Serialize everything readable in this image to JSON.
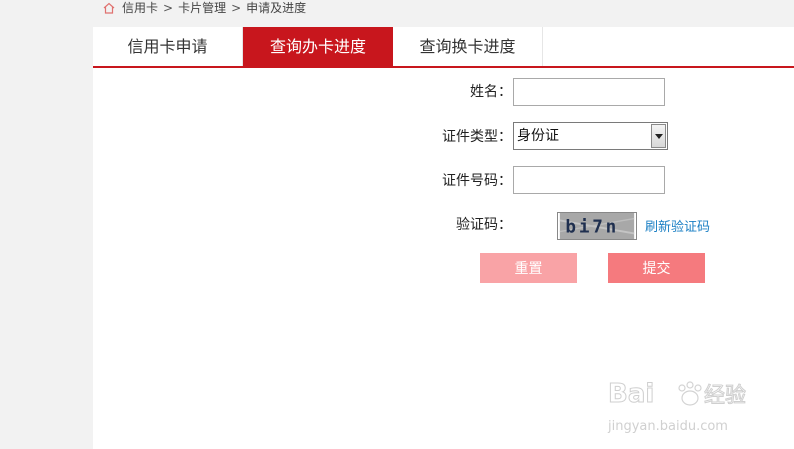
{
  "breadcrumb": {
    "item1": "信用卡",
    "item2": "卡片管理",
    "item3": "申请及进度",
    "sep": ">"
  },
  "tabs": [
    {
      "label": "信用卡申请"
    },
    {
      "label": "查询办卡进度"
    },
    {
      "label": "查询换卡进度"
    }
  ],
  "form": {
    "name_label": "姓名：",
    "name_value": "",
    "id_type_label": "证件类型：",
    "id_type_value": "身份证",
    "id_number_label": "证件号码：",
    "id_number_value": "",
    "captcha_label": "验证码：",
    "captcha_text": "bi7n",
    "refresh_label": "刷新验证码"
  },
  "buttons": {
    "reset": "重置",
    "submit": "提交"
  },
  "watermark": {
    "brand": "Baidu",
    "cn": "经验",
    "url": "jingyan.baidu.com"
  },
  "colors": {
    "accent": "#c8161d",
    "link": "#1a7fc4",
    "reset_btn": "#f9a3a6",
    "submit_btn": "#f57a7e"
  }
}
